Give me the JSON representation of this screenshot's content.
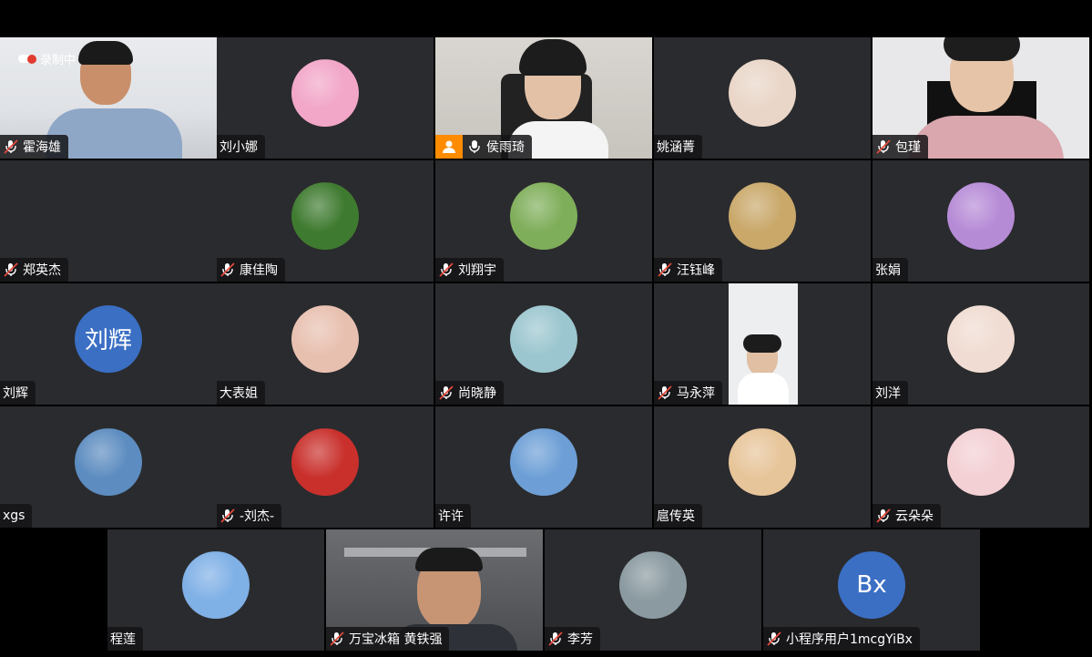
{
  "recording": {
    "label": "录制中"
  },
  "participants": [
    {
      "name": "霍海雄",
      "muted": true,
      "kind": "video",
      "scene": "office-man"
    },
    {
      "name": "刘小娜",
      "muted": false,
      "kind": "avatar",
      "color": "#f2a6c8",
      "icon": "anime-avatar"
    },
    {
      "name": "侯雨琦",
      "muted": false,
      "kind": "video",
      "host": true,
      "scene": "woman-glasses"
    },
    {
      "name": "姚涵菁",
      "muted": false,
      "kind": "avatar",
      "color": "#e9d6c8",
      "icon": "girl-avatar"
    },
    {
      "name": "包瑾",
      "muted": true,
      "kind": "video",
      "scene": "woman-pink"
    },
    {
      "name": "郑英杰",
      "muted": true,
      "kind": "blank"
    },
    {
      "name": "康佳陶",
      "muted": true,
      "kind": "avatar",
      "color": "#3e7a2f",
      "icon": "plant-avatar"
    },
    {
      "name": "刘翔宇",
      "muted": true,
      "kind": "avatar",
      "color": "#7fae5a",
      "icon": "field-avatar"
    },
    {
      "name": "汪钰峰",
      "muted": true,
      "kind": "avatar",
      "color": "#c9a86a",
      "icon": "sunset-avatar"
    },
    {
      "name": "张娟",
      "muted": false,
      "kind": "avatar",
      "color": "#b68bd6",
      "icon": "flowers-avatar"
    },
    {
      "name": "刘辉",
      "muted": false,
      "kind": "text-avatar",
      "initials": "刘辉",
      "color": "#3b6fc4"
    },
    {
      "name": "大表姐",
      "muted": false,
      "kind": "avatar",
      "color": "#e8c0b0",
      "icon": "heart-hands-avatar"
    },
    {
      "name": "尚晓静",
      "muted": true,
      "kind": "avatar",
      "color": "#9cc6cf",
      "icon": "baby-avatar"
    },
    {
      "name": "马永萍",
      "muted": true,
      "kind": "video",
      "scene": "woman-white"
    },
    {
      "name": "刘洋",
      "muted": false,
      "kind": "avatar",
      "color": "#f0dcd2",
      "icon": "cartoon-girl-avatar"
    },
    {
      "name": "xgs",
      "muted": false,
      "kind": "avatar",
      "color": "#5c8cc0",
      "icon": "mountain-avatar"
    },
    {
      "name": "-刘杰-",
      "muted": true,
      "kind": "avatar",
      "color": "#c9302c",
      "icon": "flag-avatar"
    },
    {
      "name": "许许",
      "muted": false,
      "kind": "avatar",
      "color": "#6d9fd6",
      "icon": "ship-avatar"
    },
    {
      "name": "扈传英",
      "muted": false,
      "kind": "avatar",
      "color": "#e7c59a",
      "icon": "woman-avatar"
    },
    {
      "name": "云朵朵",
      "muted": true,
      "kind": "avatar",
      "color": "#f3d0d4",
      "icon": "anime-girl-avatar"
    },
    {
      "name": "程莲",
      "muted": false,
      "kind": "avatar",
      "color": "#7fb0e6",
      "icon": "cloud-avatar"
    },
    {
      "name": "万宝冰箱 黄铁强",
      "muted": true,
      "kind": "video",
      "scene": "man-ceiling"
    },
    {
      "name": "李芳",
      "muted": true,
      "kind": "avatar",
      "color": "#8a9aa0",
      "icon": "pebbles-avatar"
    },
    {
      "name": "小程序用户1mcgYiBx",
      "muted": true,
      "kind": "text-avatar",
      "initials": "Bx",
      "color": "#3b6fc4"
    }
  ]
}
